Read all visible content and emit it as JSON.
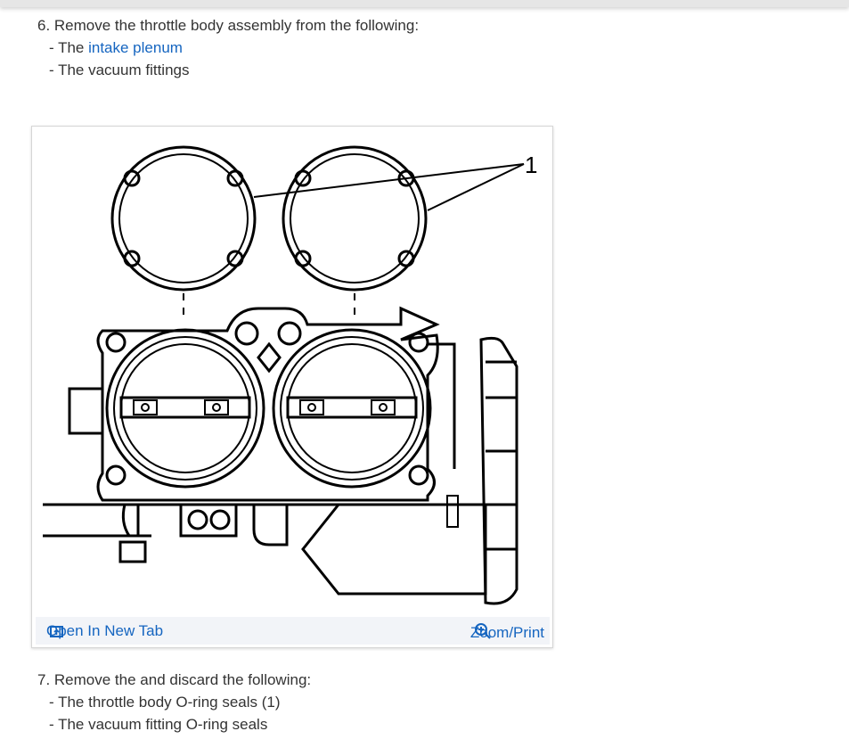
{
  "step6": {
    "text": "6. Remove the throttle body assembly from the following:",
    "items": [
      {
        "prefix": "- The ",
        "link": "intake plenum"
      },
      {
        "text": "- The vacuum fittings"
      }
    ]
  },
  "figure": {
    "callout": "1",
    "open_new_tab": "Open In New Tab",
    "zoom_print": "Zoom/Print"
  },
  "step7": {
    "text": "7. Remove the and discard the following:",
    "items": [
      "- The throttle body O-ring seals (1)",
      "- The vacuum fitting O-ring seals"
    ]
  },
  "colors": {
    "link": "#1565c0",
    "text": "#333333",
    "footer_bg": "#f2f4f8"
  }
}
